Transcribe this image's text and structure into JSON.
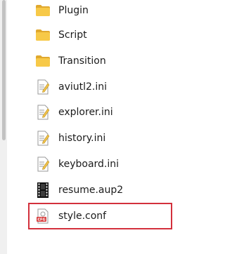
{
  "files": [
    {
      "name": "Plugin",
      "icon": "folder-icon",
      "kind": "folder"
    },
    {
      "name": "Script",
      "icon": "folder-icon",
      "kind": "folder"
    },
    {
      "name": "Transition",
      "icon": "folder-icon",
      "kind": "folder"
    },
    {
      "name": "aviutl2.ini",
      "icon": "ini-file-icon",
      "kind": "ini"
    },
    {
      "name": "explorer.ini",
      "icon": "ini-file-icon",
      "kind": "ini"
    },
    {
      "name": "history.ini",
      "icon": "ini-file-icon",
      "kind": "ini"
    },
    {
      "name": "keyboard.ini",
      "icon": "ini-file-icon",
      "kind": "ini"
    },
    {
      "name": "resume.aup2",
      "icon": "video-file-icon",
      "kind": "aup2"
    },
    {
      "name": "style.conf",
      "icon": "conf-file-icon",
      "kind": "conf",
      "icon_badge": "CFG"
    }
  ],
  "colors": {
    "folder": "#f7c948",
    "folder_dark": "#e0a82e",
    "highlight": "#d3303c",
    "conf_badge": "#d84040"
  }
}
